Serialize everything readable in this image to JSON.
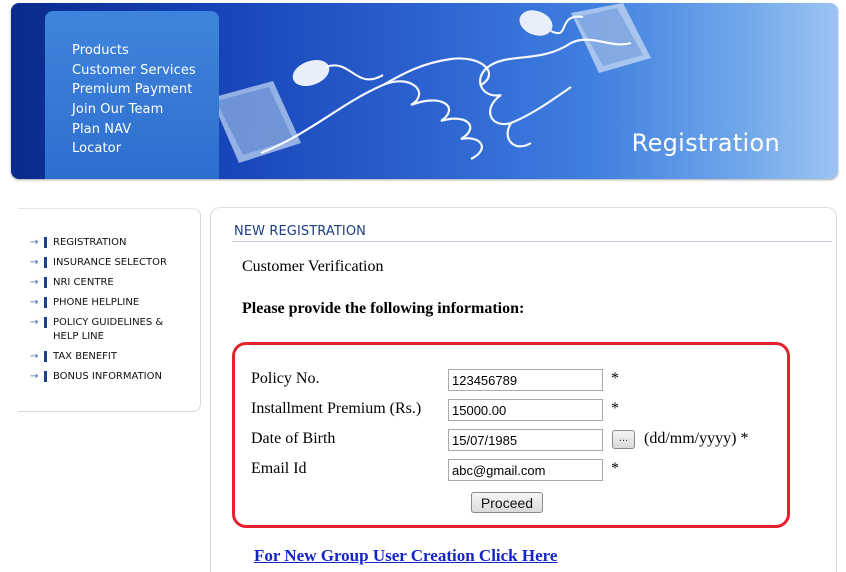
{
  "banner": {
    "nav_items": [
      {
        "label": "Products"
      },
      {
        "label": "Customer Services"
      },
      {
        "label": "Premium Payment"
      },
      {
        "label": "Join Our Team"
      },
      {
        "label": "Plan NAV"
      },
      {
        "label": "Locator"
      }
    ],
    "page_title": "Registration",
    "artwork": [
      "keyboard-icon",
      "mouse-icon",
      "hand-icon"
    ]
  },
  "sidebar": {
    "items": [
      {
        "label": "REGISTRATION",
        "icon": "arrow-right-icon"
      },
      {
        "label": "INSURANCE SELECTOR",
        "icon": "arrow-right-icon"
      },
      {
        "label": "NRI CENTRE",
        "icon": "arrow-right-icon"
      },
      {
        "label": "PHONE HELPLINE",
        "icon": "arrow-right-icon"
      },
      {
        "label": "POLICY GUIDELINES & HELP LINE",
        "icon": "arrow-right-icon"
      },
      {
        "label": "TAX BENEFIT",
        "icon": "arrow-right-icon"
      },
      {
        "label": "BONUS INFORMATION",
        "icon": "arrow-right-icon"
      }
    ]
  },
  "main": {
    "section_title": "NEW REGISTRATION",
    "subheading": "Customer Verification",
    "instruction": "Please provide the following information:",
    "form": {
      "policy_no": {
        "label": "Policy No.",
        "value": "123456789",
        "required": "*"
      },
      "installment_premium": {
        "label": "Installment Premium (Rs.)",
        "value": "15000.00",
        "required": "*"
      },
      "date_of_birth": {
        "label": "Date of Birth",
        "value": "15/07/1985",
        "calendar_button": "...",
        "format_hint": "(dd/mm/yyyy) *"
      },
      "email": {
        "label": "Email Id",
        "value": "abc@gmail.com",
        "required": "*"
      },
      "proceed_label": "Proceed"
    },
    "group_user_link": "For New Group User Creation Click Here"
  },
  "colors": {
    "banner_dark": "#0a2a8c",
    "banner_light": "#9cc4f2",
    "highlight_border": "#e3212f",
    "link": "#1424c8",
    "section_title": "#1b3e84"
  }
}
